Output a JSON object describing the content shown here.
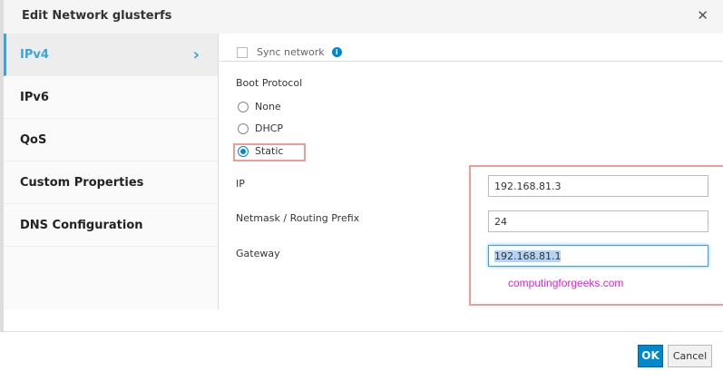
{
  "dialog": {
    "title": "Edit Network glusterfs",
    "close_icon": "close-icon"
  },
  "sidebar": {
    "items": [
      {
        "label": "IPv4",
        "active": true
      },
      {
        "label": "IPv6"
      },
      {
        "label": "QoS"
      },
      {
        "label": "Custom Properties"
      },
      {
        "label": "DNS Configuration"
      }
    ]
  },
  "content": {
    "sync_label": "Sync network",
    "boot_protocol_label": "Boot Protocol",
    "boot_options": [
      "None",
      "DHCP",
      "Static"
    ],
    "selected_boot": "Static",
    "ip_label": "IP",
    "ip_value": "192.168.81.3",
    "netmask_label": "Netmask / Routing Prefix",
    "netmask_value": "24",
    "gateway_label": "Gateway",
    "gateway_value": "192.168.81.1",
    "watermark": "computingforgeeks.com"
  },
  "footer": {
    "ok": "OK",
    "cancel": "Cancel"
  },
  "colors": {
    "accent": "#0088ce",
    "highlight": "#f09a9a",
    "watermark": "#e020e0"
  }
}
